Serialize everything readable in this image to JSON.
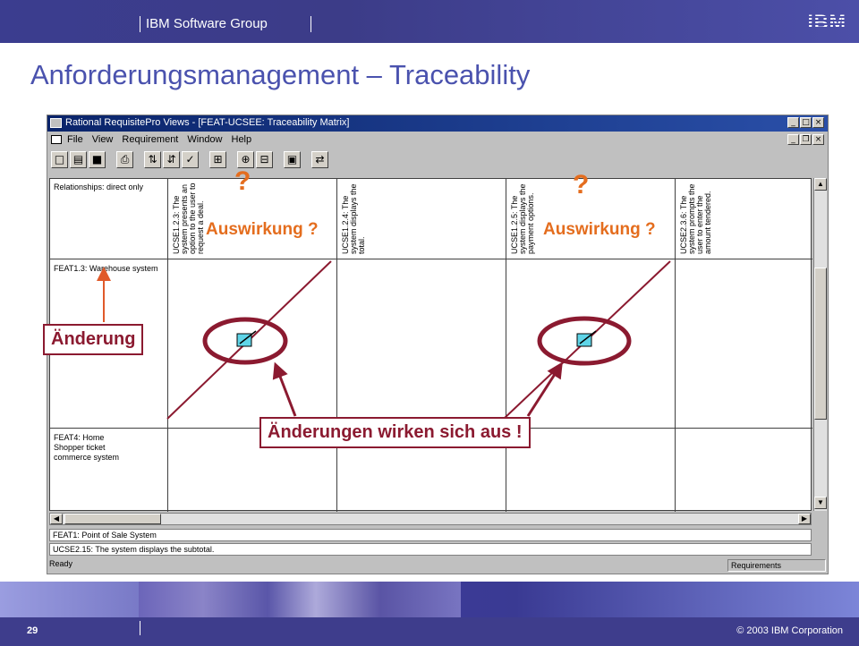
{
  "header": {
    "group_label": "IBM Software Group",
    "logo_text": "IBM",
    "title": "Anforderungsmanagement – Traceability"
  },
  "app_window": {
    "title": "Rational RequisitePro Views - [FEAT-UCSEE: Traceability Matrix]",
    "menu": [
      "File",
      "View",
      "Requirement",
      "Window",
      "Help"
    ],
    "window_controls": [
      "_",
      "□",
      "×"
    ],
    "doc_controls": [
      "_",
      "❐",
      "×"
    ],
    "toolbar_icons": [
      "new-icon",
      "open-icon",
      "save-icon",
      "print-icon",
      "filter-icon",
      "sort-icon",
      "query-icon",
      "grid-icon",
      "expand-icon",
      "collapse-icon",
      "display-icon",
      "sort-order-icon"
    ]
  },
  "matrix": {
    "corner_text": "Relationships: direct only",
    "columns": [
      "UCSE1.2.3: The system presents an option to the user to request a deal.",
      "UCSE1.2.4: The system displays the total.",
      "UCSE1.2.5: The system displays the payment options.",
      "UCSE2.3.6: The system prompts the user to enter the amount tendered."
    ],
    "rows": [
      "FEAT1.3: Warehouse system",
      "FEAT4: Home Shopper ticket commerce system"
    ]
  },
  "info_lines": [
    "FEAT1: Point of Sale System",
    "UCSE2.15: The system displays the subtotal."
  ],
  "status": {
    "left": "Ready",
    "right": "Requirements"
  },
  "annotations": {
    "question_mark": "?",
    "impact_label": "Auswirkung ?",
    "change_label": "Änderung",
    "effect_label": "Änderungen wirken sich aus !",
    "accent_color": "#e46d1e",
    "callout_color": "#8b1a30"
  },
  "footer": {
    "page_number": "29",
    "copyright": "© 2003 IBM Corporation"
  }
}
